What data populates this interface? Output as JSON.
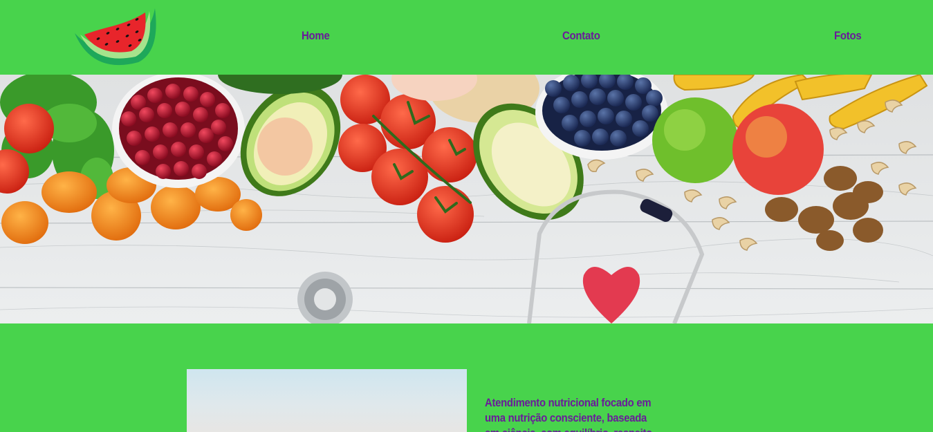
{
  "nav": {
    "items": [
      {
        "label": "Home"
      },
      {
        "label": "Contato"
      },
      {
        "label": "Fotos"
      }
    ]
  },
  "content": {
    "text_lines": [
      "Atendimento nutricional focado em",
      "uma nutrição consciente, baseada",
      "em ciência, com equilíbrio, respeito"
    ]
  },
  "colors": {
    "background": "#48d34c",
    "nav_text": "#6a1b9a"
  },
  "icons": {
    "logo": "watermelon-slice-icon"
  }
}
